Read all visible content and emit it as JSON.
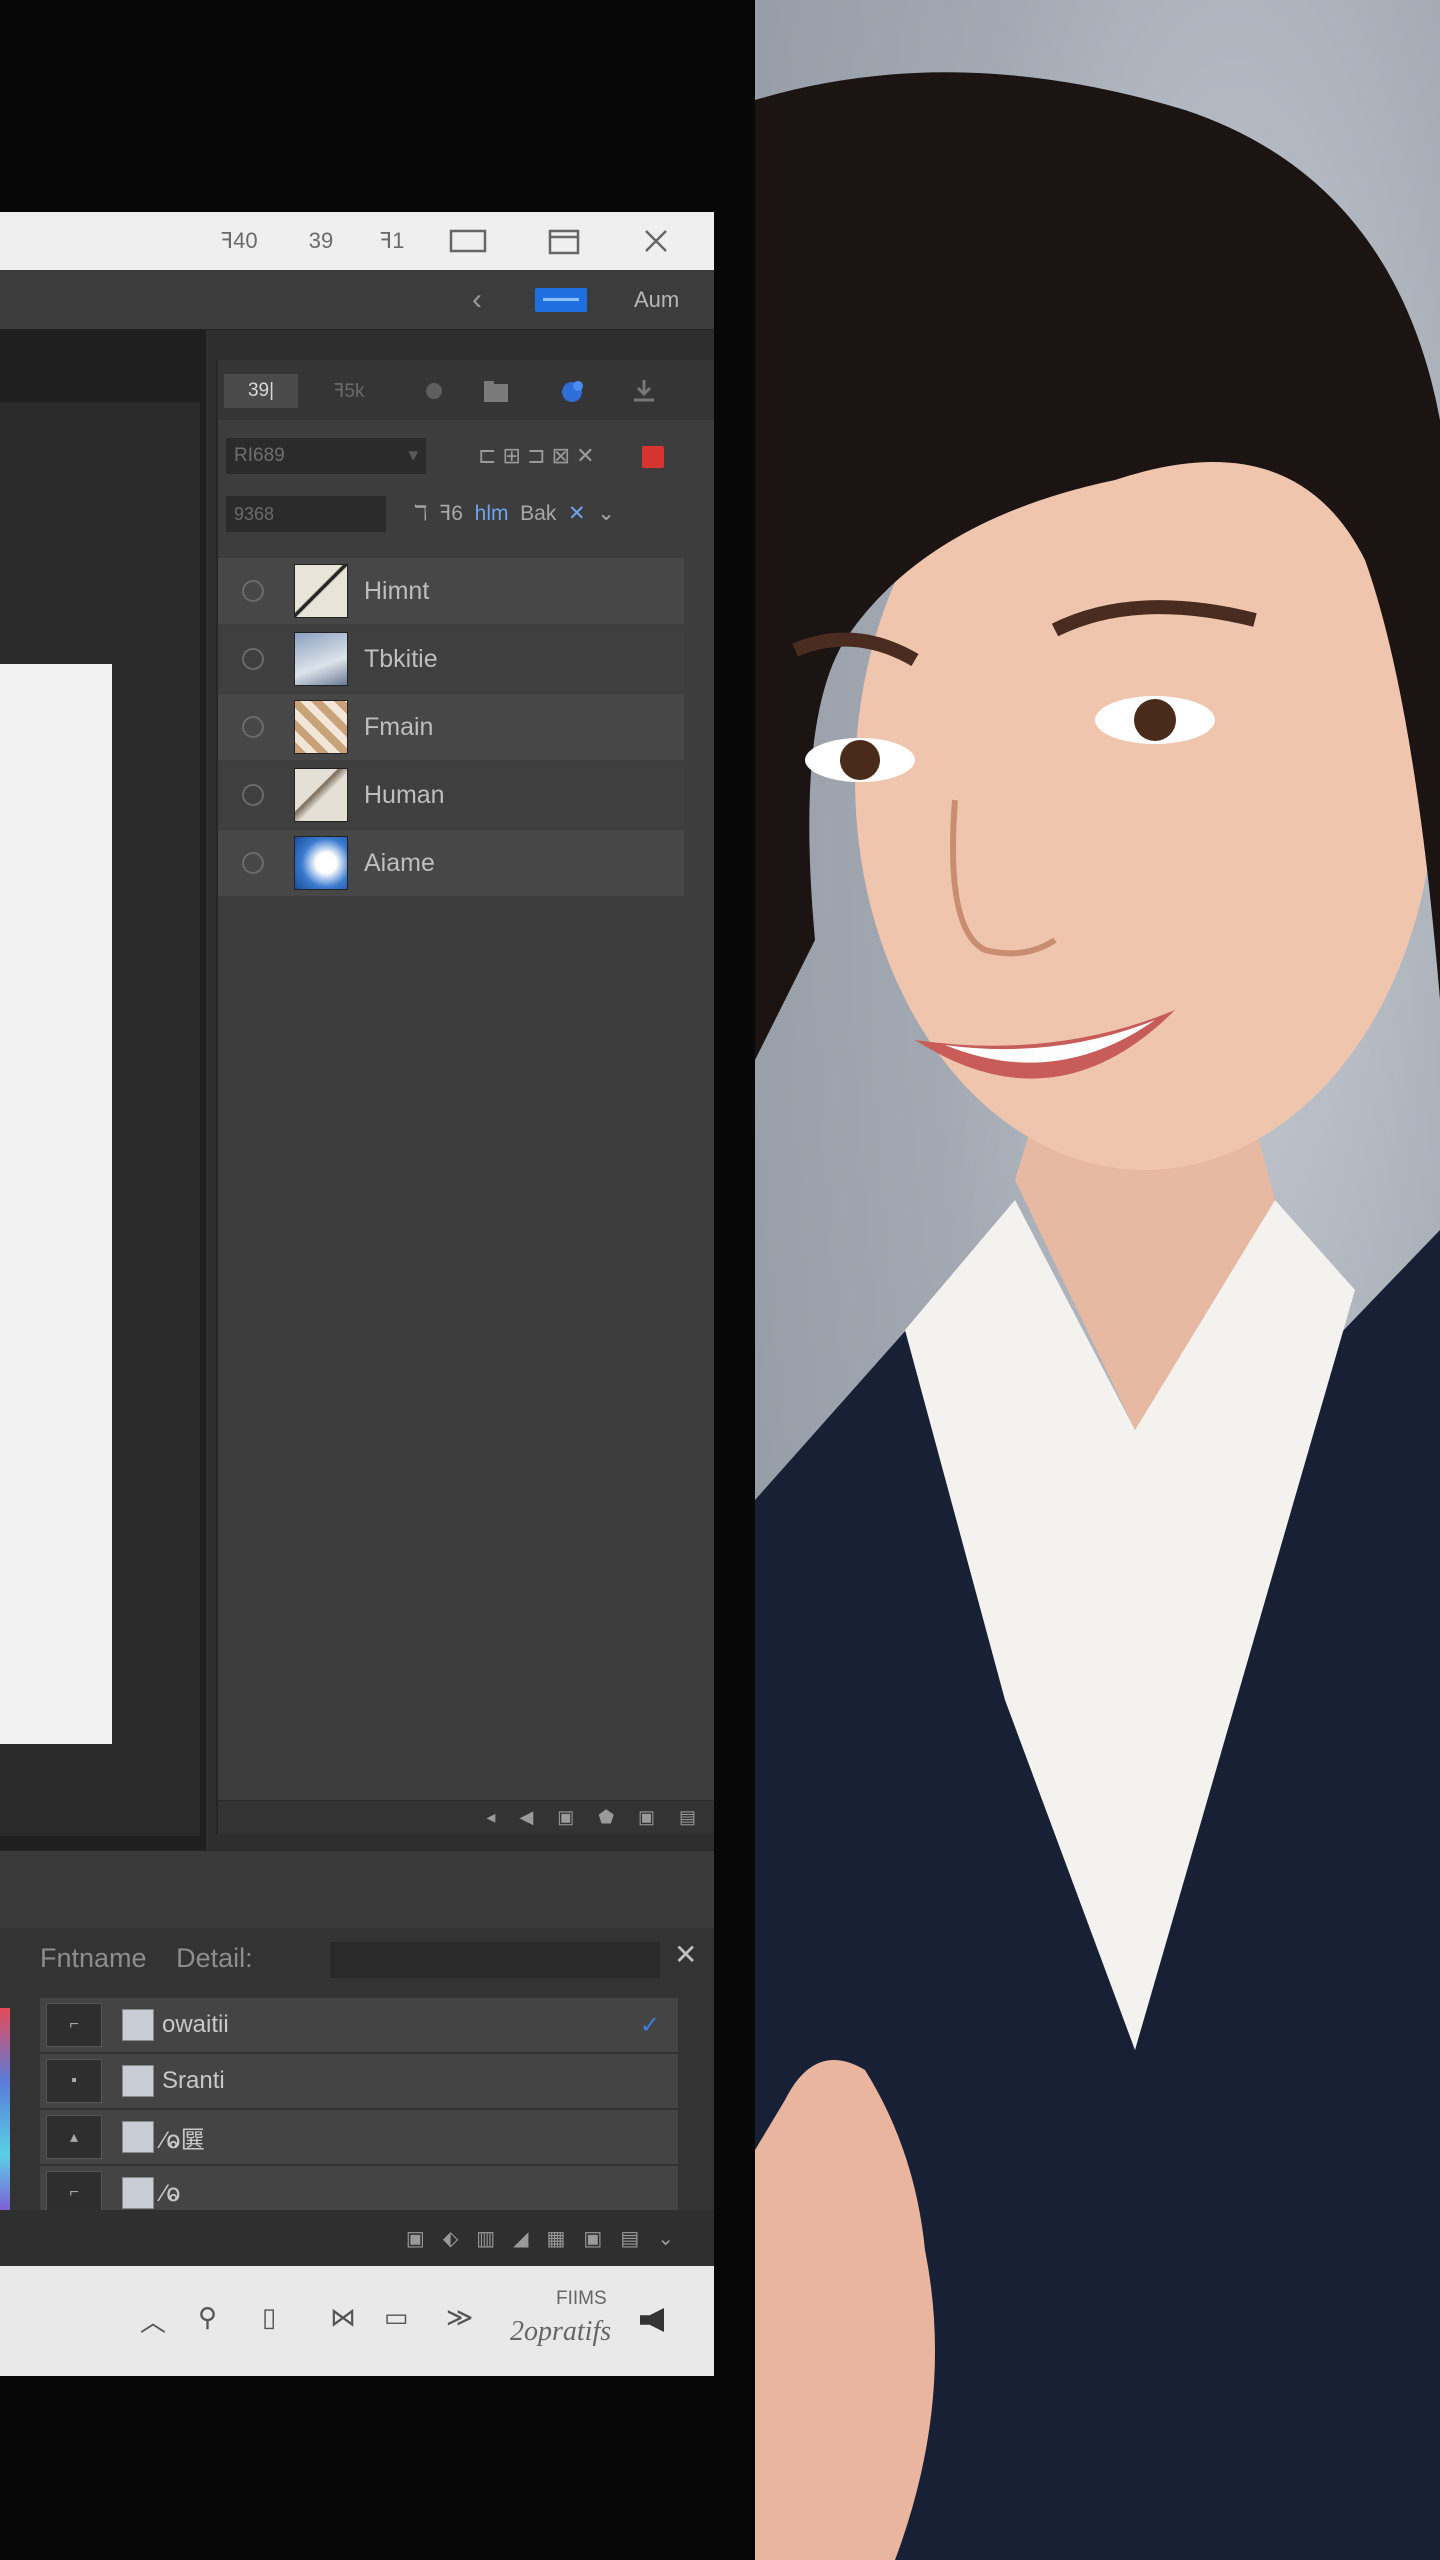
{
  "titlebar": {
    "items": [
      "ꟻ40",
      "39",
      "ꟻ1"
    ]
  },
  "toolbar": {
    "label": "Aum"
  },
  "layers_panel": {
    "tabs": [
      "39|",
      "ꟻ5k"
    ],
    "blend_mode": "RI689",
    "row1_misc": "⊏ ⊞ ⊐ ⊠ ✕",
    "search": "9368",
    "row2": [
      "ℸ",
      "ꟻ6",
      "hlm",
      "Bak",
      "✕",
      "⌄"
    ],
    "layers": [
      {
        "name": "Himnt"
      },
      {
        "name": "Tbkitie"
      },
      {
        "name": "Fmain"
      },
      {
        "name": "Human"
      },
      {
        "name": "Aiame"
      }
    ],
    "footer_icons": [
      "◂",
      "◀",
      "▣",
      "⬟",
      "▣",
      "▤"
    ]
  },
  "lower_panel": {
    "tabs": [
      "Fntname",
      "Detail:"
    ],
    "rows": [
      {
        "name": "owaitii",
        "checked": true
      },
      {
        "name": "Sranti",
        "checked": false
      },
      {
        "name": "⁄ⱺ㔵",
        "checked": false
      },
      {
        "name": "⁄ⱺ",
        "checked": false
      }
    ]
  },
  "taskbar": {
    "time_line1": "FIIMS",
    "time_line2": "2opratifs"
  },
  "colors": {
    "accent": "#1f6fe0",
    "danger": "#d7342f"
  }
}
